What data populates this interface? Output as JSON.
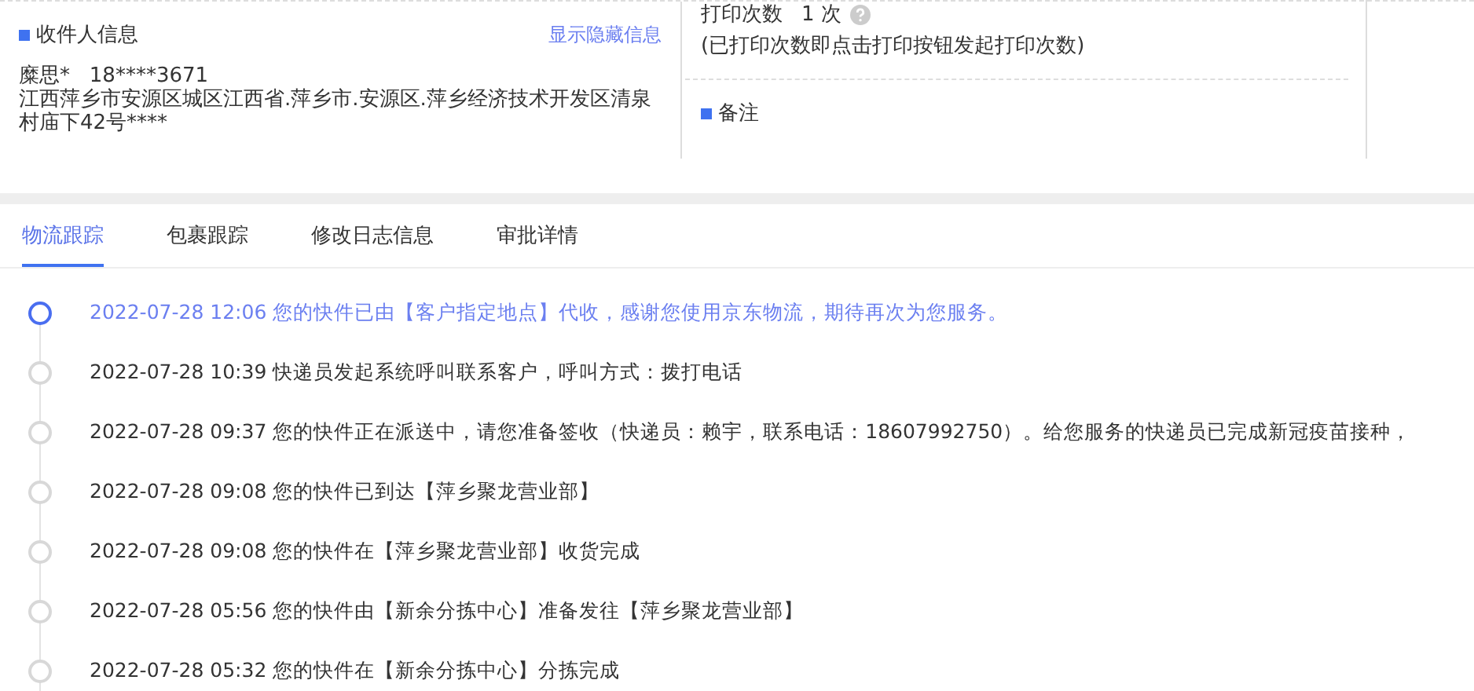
{
  "recipient": {
    "title": "收件人信息",
    "toggle_link": "显示隐藏信息",
    "name": "糜思*",
    "phone": "18****3671",
    "address": "江西萍乡市安源区城区江西省.萍乡市.安源区.萍乡经济技术开发区清泉村庙下42号****"
  },
  "print_info": {
    "label": "打印次数",
    "count": "1 次",
    "note": "(已打印次数即点击打印按钮发起打印次数)"
  },
  "remarks": {
    "title": "备注"
  },
  "tabs": [
    {
      "label": "物流跟踪",
      "selected": true
    },
    {
      "label": "包裹跟踪",
      "selected": false
    },
    {
      "label": "修改日志信息",
      "selected": false
    },
    {
      "label": "审批详情",
      "selected": false
    }
  ],
  "tracking": [
    {
      "text": "2022-07-28 12:06 您的快件已由【客户指定地点】代收，感谢您使用京东物流，期待再次为您服务。",
      "latest": true
    },
    {
      "text": "2022-07-28 10:39 快递员发起系统呼叫联系客户，呼叫方式：拨打电话",
      "latest": false
    },
    {
      "text": "2022-07-28 09:37 您的快件正在派送中，请您准备签收（快递员：赖宇，联系电话：18607992750）。给您服务的快递员已完成新冠疫苗接种，",
      "latest": false
    },
    {
      "text": "2022-07-28 09:08 您的快件已到达【萍乡聚龙营业部】",
      "latest": false
    },
    {
      "text": "2022-07-28 09:08 您的快件在【萍乡聚龙营业部】收货完成",
      "latest": false
    },
    {
      "text": "2022-07-28 05:56 您的快件由【新余分拣中心】准备发往【萍乡聚龙营业部】",
      "latest": false
    },
    {
      "text": "2022-07-28 05:32 您的快件在【新余分拣中心】分拣完成",
      "latest": false
    }
  ]
}
